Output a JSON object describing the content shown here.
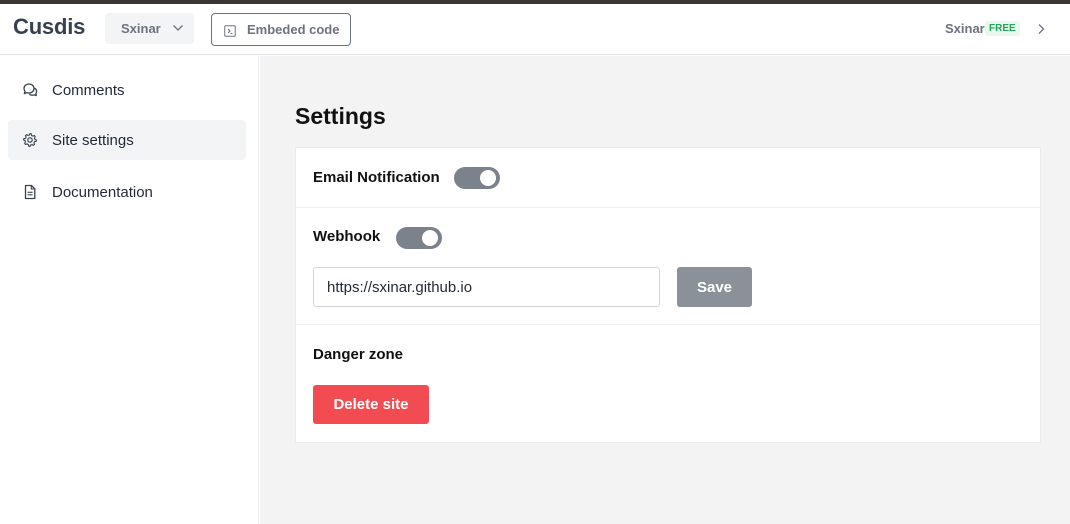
{
  "header": {
    "logo": "Cusdis",
    "site_select": {
      "value": "Sxinar",
      "icon": "chevron-down-icon"
    },
    "embed_button": {
      "label": "Embeded code",
      "icon": "code-icon"
    },
    "user": {
      "name": "Sxinar",
      "plan_badge": "FREE",
      "icon": "chevron-right-icon"
    }
  },
  "sidebar": {
    "items": [
      {
        "label": "Comments",
        "icon": "chat-icon",
        "active": false
      },
      {
        "label": "Site settings",
        "icon": "gear-icon",
        "active": true
      },
      {
        "label": "Documentation",
        "icon": "document-icon",
        "active": false
      }
    ]
  },
  "main": {
    "title": "Settings",
    "email_notification": {
      "label": "Email Notification",
      "enabled": true
    },
    "webhook": {
      "label": "Webhook",
      "enabled": true,
      "url_value": "https://sxinar.github.io",
      "save_label": "Save"
    },
    "danger_zone": {
      "label": "Danger zone",
      "delete_label": "Delete site"
    }
  },
  "colors": {
    "accent_danger": "#f24c52",
    "toggle_on": "#7c828b",
    "save_button": "#8a9198",
    "badge_text": "#22a55b",
    "badge_bg": "#e9f7ee",
    "main_bg": "#f3f3f3"
  }
}
